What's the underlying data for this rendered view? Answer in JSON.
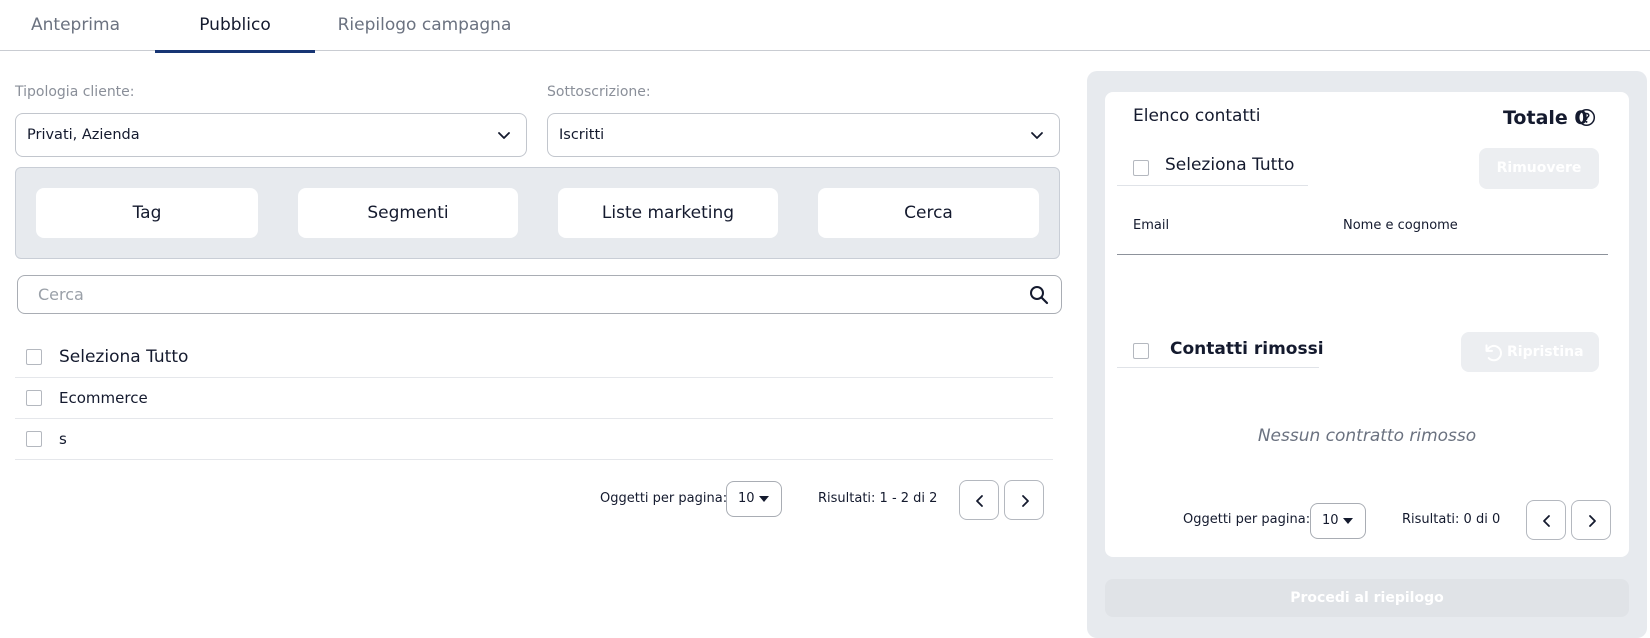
{
  "tabs": [
    {
      "label": "Anteprima"
    },
    {
      "label": "Pubblico"
    },
    {
      "label": "Riepilogo campagna"
    }
  ],
  "filters": {
    "customer_type_label": "Tipologia cliente:",
    "customer_type_value": "Privati, Azienda",
    "subscription_label": "Sottoscrizione:",
    "subscription_value": "Iscritti"
  },
  "filter_buttons": [
    "Tag",
    "Segmenti",
    "Liste marketing",
    "Cerca"
  ],
  "search": {
    "placeholder": "Cerca"
  },
  "list": {
    "select_all": "Seleziona Tutto",
    "items": [
      "Ecommerce",
      "s"
    ]
  },
  "pagination": {
    "per_page_label": "Oggetti per pagina:",
    "per_page_value": "10",
    "results": "Risultati: 1 - 2 di 2"
  },
  "contacts": {
    "title": "Elenco contatti",
    "total": "Totale 0",
    "select_all": "Seleziona Tutto",
    "remove_label": "Rimuovere",
    "col_email": "Email",
    "col_name": "Nome e cognome",
    "removed_title": "Contatti rimossi",
    "restore_label": "Ripristina",
    "empty_message": "Nessun contratto rimosso",
    "per_page_label": "Oggetti per pagina:",
    "per_page_value": "10",
    "results": "Risultati: 0 di 0",
    "proceed_label": "Procedi al riepilogo"
  },
  "colors": {
    "accent": "#173574",
    "panel": "#e7eaee"
  }
}
